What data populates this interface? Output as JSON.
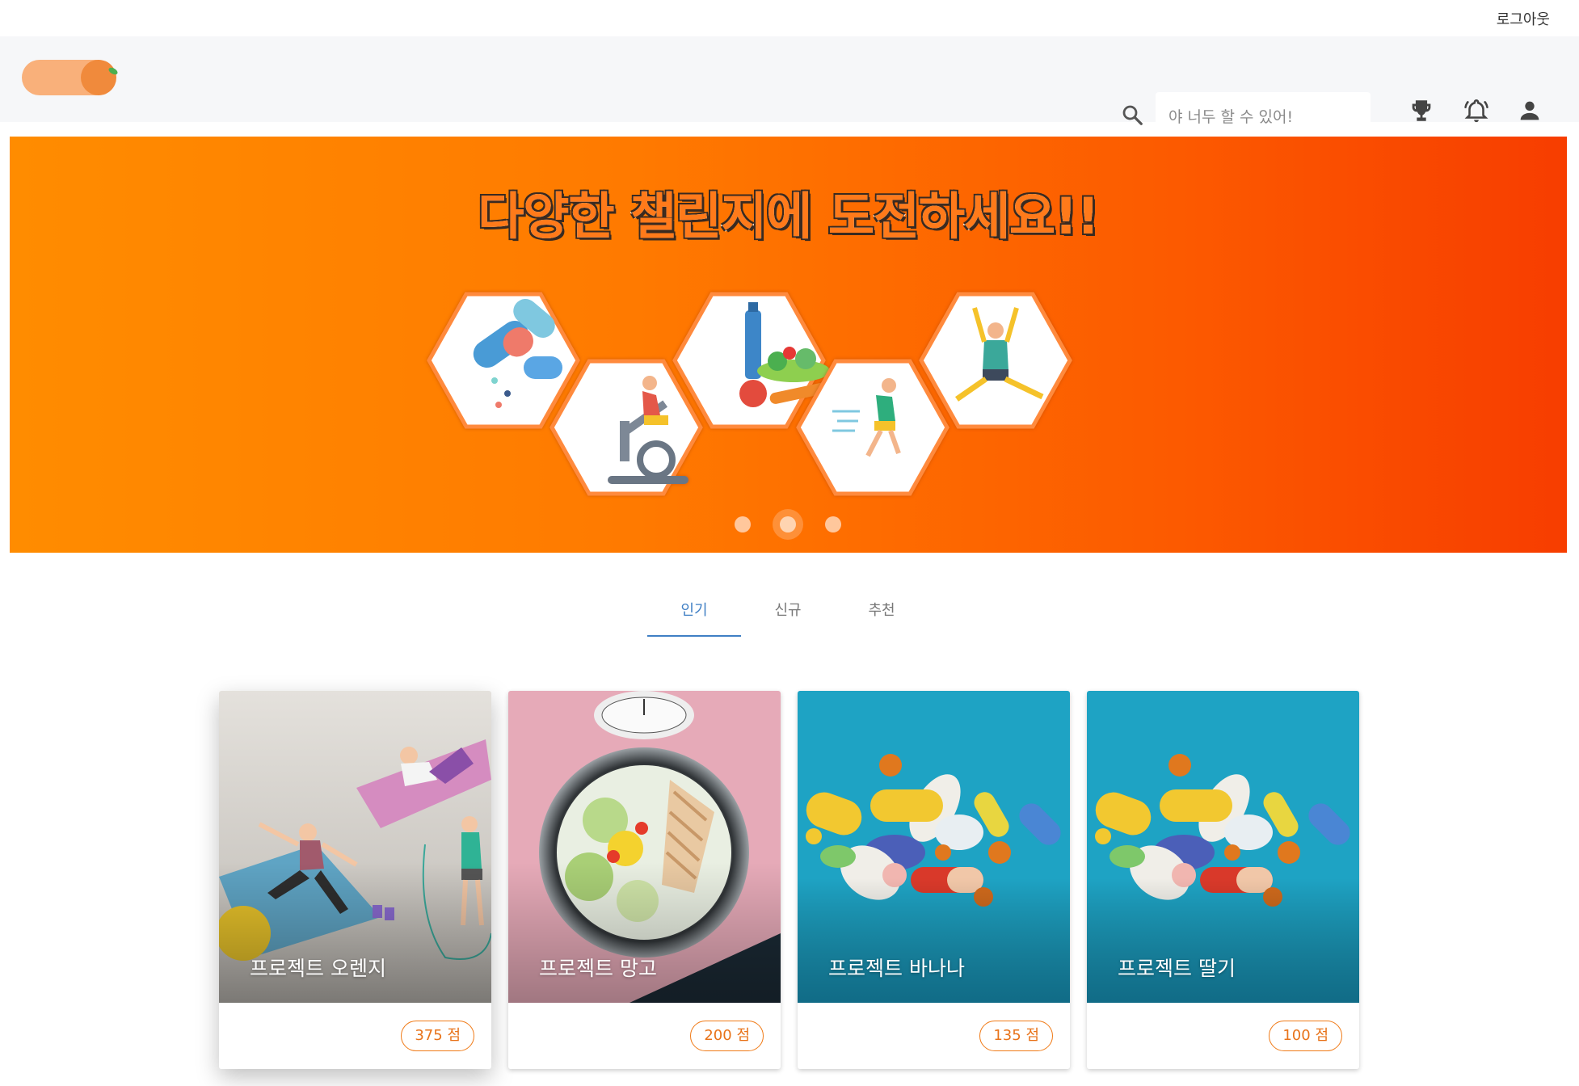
{
  "topbar": {
    "logout_label": "로그아웃"
  },
  "header": {
    "search": {
      "placeholder": "야 너두 할 수 있어!"
    },
    "icons": [
      "search-icon",
      "trophy-icon",
      "bell-icon",
      "person-icon"
    ]
  },
  "banner": {
    "title": "다양한 챌린지에 도전하세요!!",
    "slides": 3,
    "active_slide": 2,
    "illustrations": [
      "capsules",
      "exercise-bike",
      "healthy-food",
      "runner",
      "stretching"
    ]
  },
  "tabs": [
    {
      "label": "인기",
      "active": true
    },
    {
      "label": "신규",
      "active": false
    },
    {
      "label": "추천",
      "active": false
    }
  ],
  "cards": [
    {
      "title": "프로젝트 오렌지",
      "score": "375 점",
      "image": "yoga-workout"
    },
    {
      "title": "프로젝트 망고",
      "score": "200 점",
      "image": "salad-scale"
    },
    {
      "title": "프로젝트 바나나",
      "score": "135 점",
      "image": "pills"
    },
    {
      "title": "프로젝트 딸기",
      "score": "100 점",
      "image": "pills"
    }
  ],
  "colors": {
    "accent": "#f07b18",
    "tab_active": "#3f7fc4",
    "banner_start": "#ff8c00",
    "banner_end": "#f73d00"
  }
}
